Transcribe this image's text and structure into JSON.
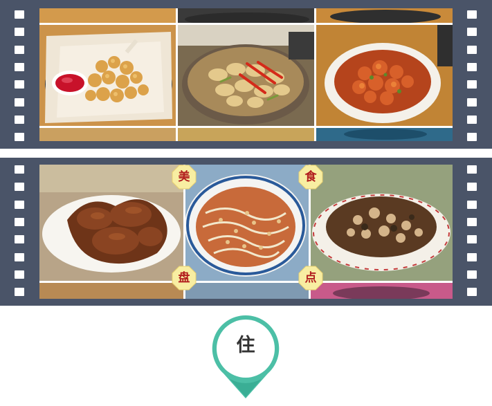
{
  "strips": {
    "top": {
      "photos": [
        "fried-chicken-nuggets",
        "clams-with-chili",
        "spicy-shrimp"
      ]
    },
    "bottom": {
      "photos": [
        "roast-chicken",
        "noodle-soup",
        "stir-fried-dish"
      ],
      "badges": {
        "mei": "美",
        "shi": "食",
        "pan": "盘",
        "dian": "点"
      }
    }
  },
  "pin": {
    "label": "住",
    "color": "#4cbfa6"
  },
  "colors": {
    "film": "#4a5468",
    "badge": "#f8eea2",
    "badge_text": "#b21e1e"
  }
}
